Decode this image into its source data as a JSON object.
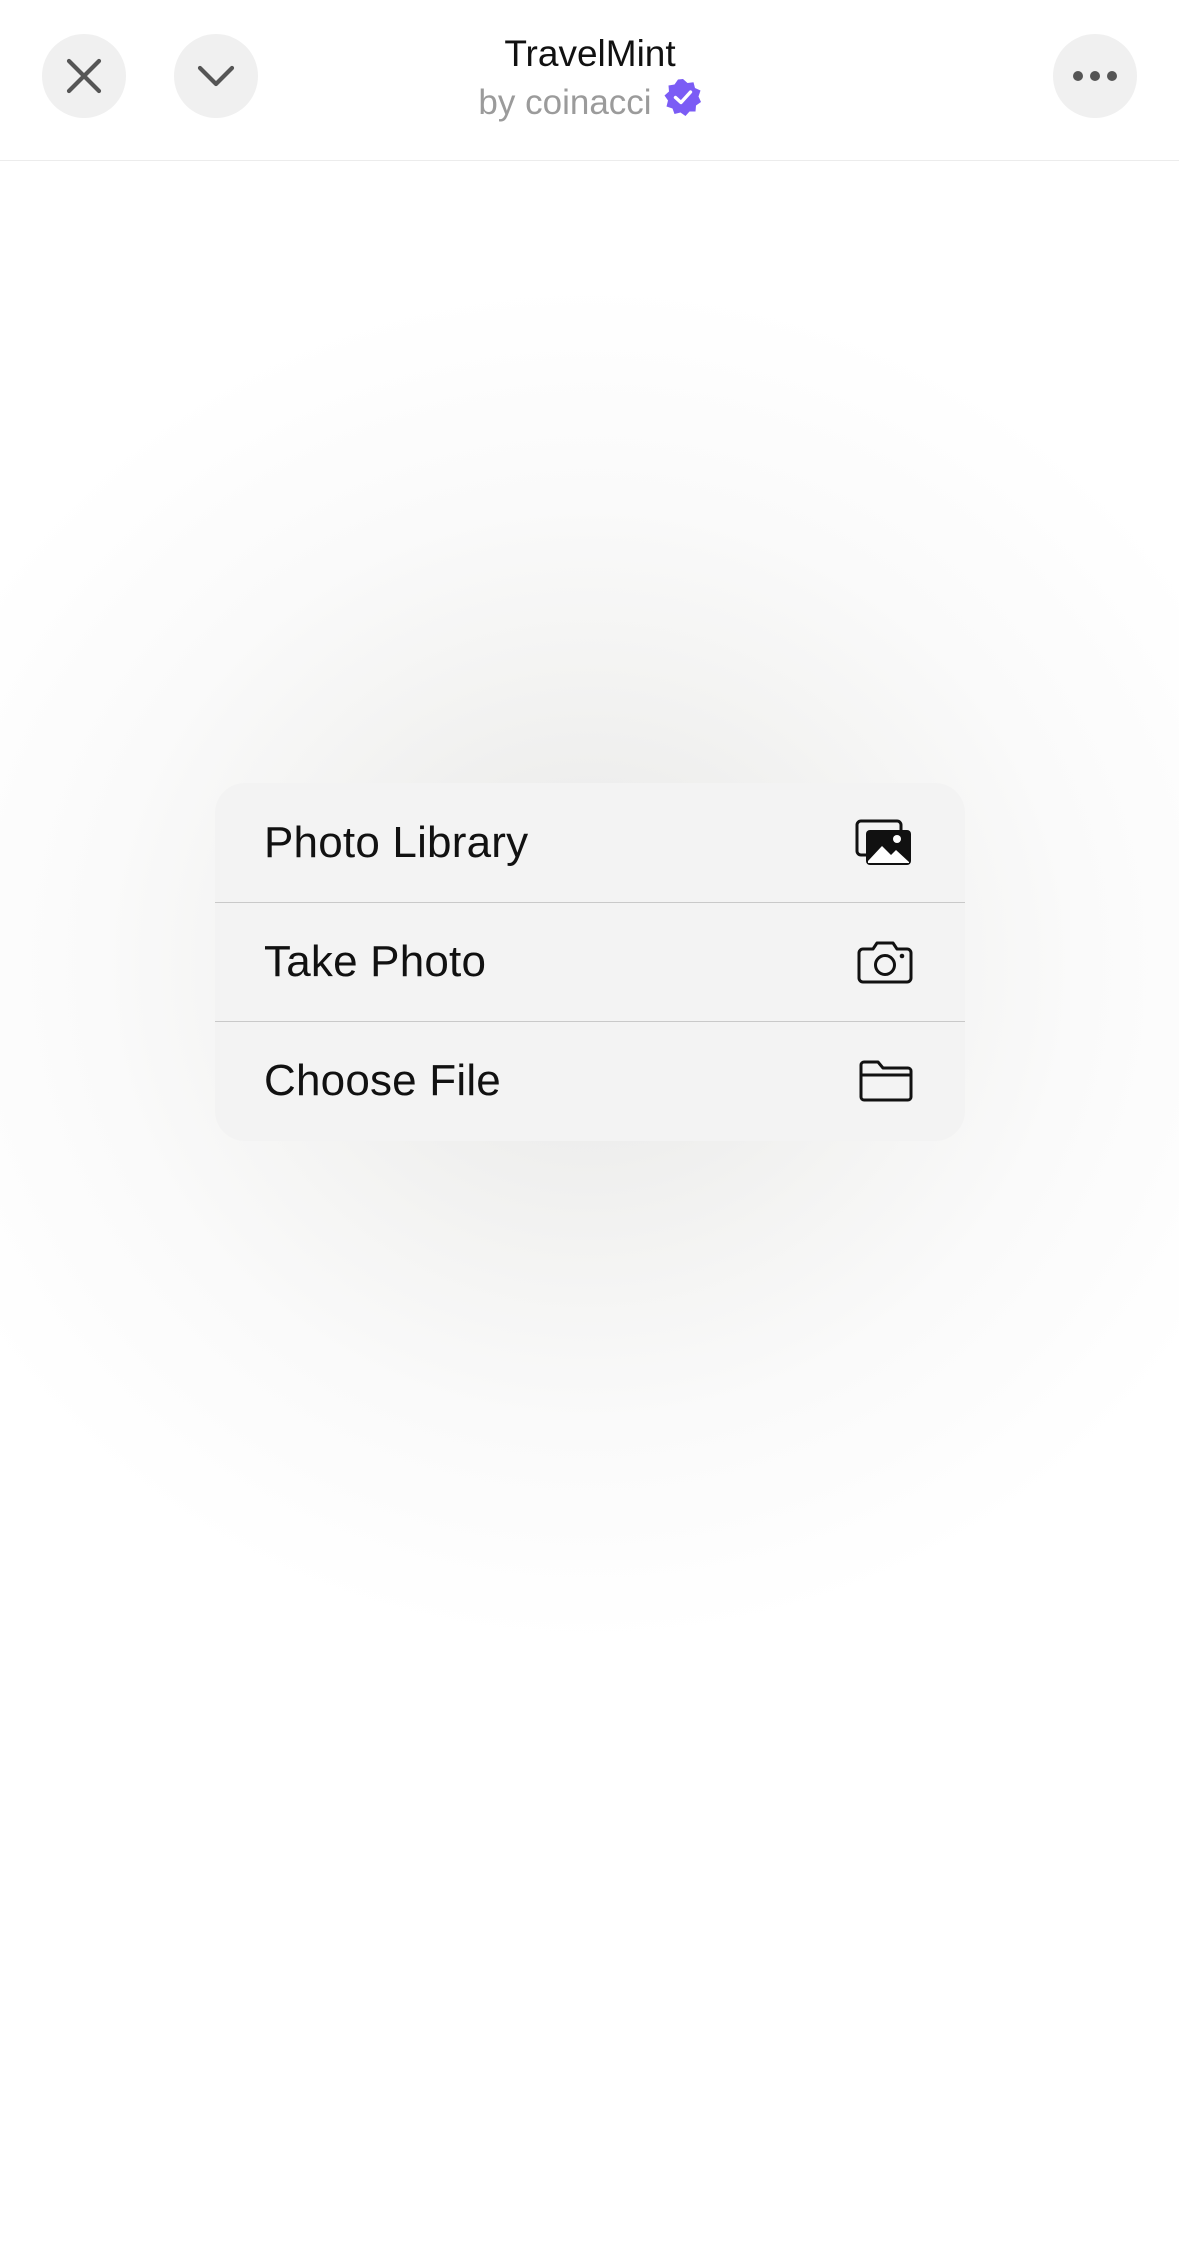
{
  "header": {
    "title": "TravelMint",
    "subtitle": "by coinacci",
    "verified_color": "#7b5cf5",
    "buttons": [
      {
        "icon": "close-icon"
      },
      {
        "icon": "chevron-down-icon"
      },
      {
        "icon": "more-icon"
      }
    ]
  },
  "menu": {
    "items": [
      {
        "label": "Photo Library",
        "icon": "photo-library-icon"
      },
      {
        "label": "Take Photo",
        "icon": "camera-icon"
      },
      {
        "label": "Choose File",
        "icon": "folder-icon"
      }
    ]
  }
}
